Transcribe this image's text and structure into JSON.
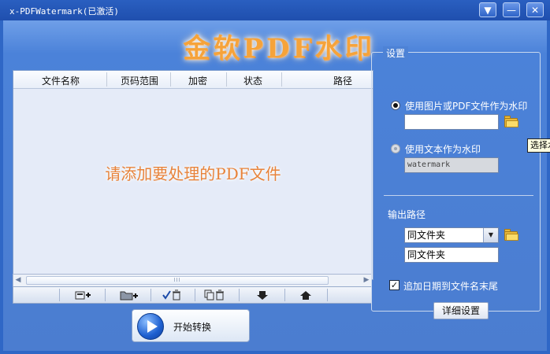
{
  "window": {
    "title": "x-PDFWatermark(已激活)",
    "buttons": {
      "menu": "▼",
      "minimize": "—",
      "close": "✕"
    }
  },
  "brand_title": "金软PDF水印",
  "file_table": {
    "columns": [
      "文件名称",
      "页码范围",
      "加密",
      "状态",
      "路径"
    ],
    "placeholder": "请添加要处理的PDF文件",
    "scroll_grip": "III"
  },
  "toolbar": {
    "icons": [
      "add-file-icon",
      "add-folder-icon",
      "remove-checked-icon",
      "remove-all-icon",
      "move-down-icon",
      "move-up-icon"
    ]
  },
  "start_button": {
    "label": "开始转换"
  },
  "settings": {
    "title": "设置",
    "image_option": {
      "label": "使用图片或PDF文件作为水印",
      "selected": true,
      "value": ""
    },
    "text_option": {
      "label": "使用文本作为水印",
      "selected": false,
      "value": "watermark"
    },
    "browse_tooltip": "选择水印文",
    "output": {
      "label": "输出路径",
      "combo_value": "同文件夹",
      "path_value": "同文件夹"
    },
    "append_date": {
      "label": "追加日期到文件名末尾",
      "checked": true
    },
    "details_button": "详细设置"
  },
  "colors": {
    "accent": "#f6a33a",
    "placeholder_text": "#e8833a",
    "background": "#4b82d9"
  }
}
